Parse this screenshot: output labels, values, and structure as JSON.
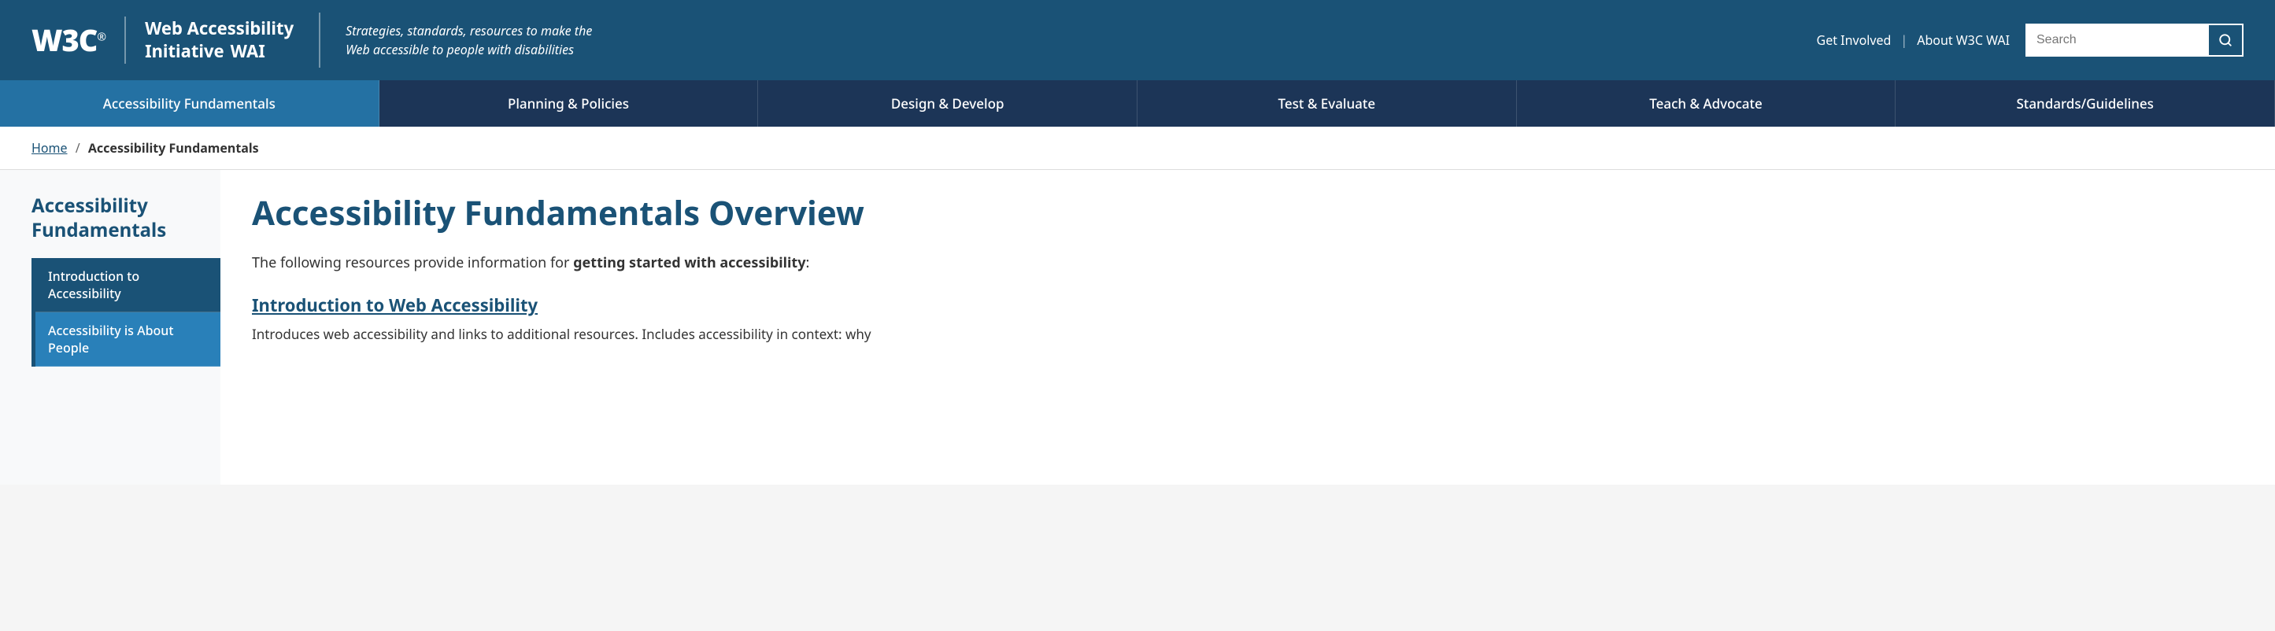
{
  "header": {
    "w3c_logo": "W3C",
    "w3c_reg": "®",
    "wai_line1": "Web Accessibility",
    "wai_line2": "Initiative",
    "wai_abbr": "WAI",
    "tagline": "Strategies, standards, resources to make the Web accessible to people with disabilities",
    "link_get_involved": "Get Involved",
    "link_about": "About W3C WAI",
    "search_placeholder": "Search",
    "search_icon": "🔍"
  },
  "nav": {
    "items": [
      {
        "label": "Accessibility Fundamentals",
        "active": true
      },
      {
        "label": "Planning & Policies",
        "active": false
      },
      {
        "label": "Design & Develop",
        "active": false
      },
      {
        "label": "Test & Evaluate",
        "active": false
      },
      {
        "label": "Teach & Advocate",
        "active": false
      },
      {
        "label": "Standards/Guidelines",
        "active": false
      }
    ]
  },
  "breadcrumb": {
    "home": "Home",
    "separator": "/",
    "current": "Accessibility Fundamentals"
  },
  "sidebar": {
    "title": "Accessibility Fundamentals",
    "items": [
      {
        "label": "Introduction to Accessibility"
      },
      {
        "label": "Accessibility is About People"
      }
    ]
  },
  "main": {
    "page_title": "Accessibility Fundamentals Overview",
    "intro": "The following resources provide information for ",
    "intro_bold": "getting started with accessibility",
    "intro_end": ":",
    "resource_link": "Introduction to Web Accessibility",
    "resource_desc": "Introduces web accessibility and links to additional resources. Includes accessibility in context: why"
  }
}
